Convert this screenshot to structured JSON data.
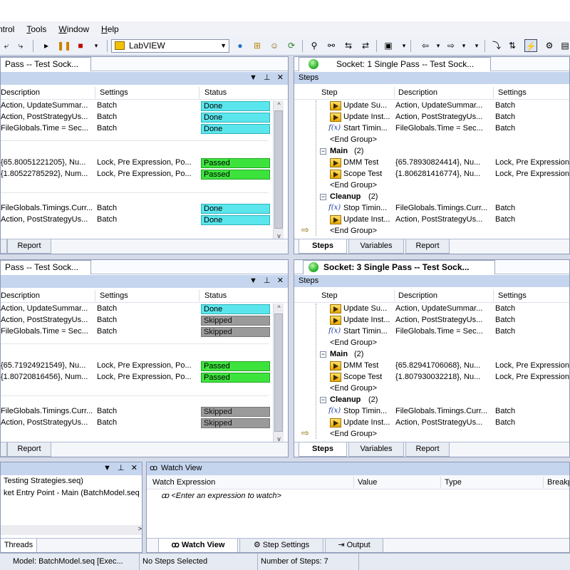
{
  "menu": [
    "ntrol",
    "Tools",
    "Window",
    "Help"
  ],
  "toolbar": {
    "adapter": "LabVIEW"
  },
  "pane1": {
    "tab": "Pass -- Test Sock...",
    "columns": [
      "Description",
      "Settings",
      "Status"
    ],
    "rows": [
      {
        "desc": "Action,  UpdateSummar...",
        "settings": "Batch",
        "status": "Done",
        "kind": "done"
      },
      {
        "desc": "Action,  PostStrategyUs...",
        "settings": "Batch",
        "status": "Done",
        "kind": "done"
      },
      {
        "desc": "FileGlobals.Time = Sec...",
        "settings": "Batch",
        "status": "Done",
        "kind": "done"
      },
      {
        "desc": "{65.80051221205}, Nu...",
        "settings": "Lock, Pre Expression, Po...",
        "status": "Passed",
        "kind": "passed"
      },
      {
        "desc": "{1.80522785292}, Num...",
        "settings": "Lock, Pre Expression, Po...",
        "status": "Passed",
        "kind": "passed"
      },
      {
        "desc": "FileGlobals.Timings.Curr...",
        "settings": "Batch",
        "status": "Done",
        "kind": "done"
      },
      {
        "desc": "Action,  PostStrategyUs...",
        "settings": "Batch",
        "status": "Done",
        "kind": "done"
      }
    ],
    "report_tab": "Report"
  },
  "pane2": {
    "tab": "Socket: 1  Single Pass -- Test Sock...",
    "subbar": "Steps",
    "columns": [
      "Step",
      "Description",
      "Settings"
    ],
    "rows": [
      {
        "type": "step",
        "step": "Update Su...",
        "desc": "Action,  UpdateSummar...",
        "settings": "Batch"
      },
      {
        "type": "step",
        "step": "Update Inst...",
        "desc": "Action,  PostStrategyUs...",
        "settings": "Batch"
      },
      {
        "type": "fx",
        "step": "Start Timin...",
        "desc": "FileGlobals.Time = Sec...",
        "settings": "Batch"
      },
      {
        "type": "end",
        "step": "<End Group>",
        "desc": "",
        "settings": ""
      },
      {
        "type": "group",
        "step": "Main",
        "count": "(2)"
      },
      {
        "type": "step",
        "step": "DMM Test",
        "desc": "{65.78930824414}, Nu...",
        "settings": "Lock, Pre Expression"
      },
      {
        "type": "step",
        "step": "Scope Test",
        "desc": "{1.806281416774}, Nu...",
        "settings": "Lock, Pre Expression"
      },
      {
        "type": "end",
        "step": "<End Group>",
        "desc": "",
        "settings": ""
      },
      {
        "type": "group",
        "step": "Cleanup",
        "count": "(2)"
      },
      {
        "type": "fx",
        "step": "Stop Timin...",
        "desc": "FileGlobals.Timings.Curr...",
        "settings": "Batch"
      },
      {
        "type": "step",
        "step": "Update Inst...",
        "desc": "Action,  PostStrategyUs...",
        "settings": "Batch"
      },
      {
        "type": "end",
        "step": "<End Group>",
        "desc": "",
        "settings": ""
      }
    ],
    "tabs": [
      "Steps",
      "Variables",
      "Report"
    ]
  },
  "pane3": {
    "tab": "Pass -- Test Sock...",
    "columns": [
      "Description",
      "Settings",
      "Status"
    ],
    "rows": [
      {
        "desc": "Action,  UpdateSummar...",
        "settings": "Batch",
        "status": "Done",
        "kind": "done"
      },
      {
        "desc": "Action,  PostStrategyUs...",
        "settings": "Batch",
        "status": "Skipped",
        "kind": "skipped"
      },
      {
        "desc": "FileGlobals.Time = Sec...",
        "settings": "Batch",
        "status": "Skipped",
        "kind": "skipped"
      },
      {
        "desc": "{65.71924921549}, Nu...",
        "settings": "Lock, Pre Expression, Po...",
        "status": "Passed",
        "kind": "passed"
      },
      {
        "desc": "{1.80720816456}, Num...",
        "settings": "Lock, Pre Expression, Po...",
        "status": "Passed",
        "kind": "passed"
      },
      {
        "desc": "FileGlobals.Timings.Curr...",
        "settings": "Batch",
        "status": "Skipped",
        "kind": "skipped"
      },
      {
        "desc": "Action,  PostStrategyUs...",
        "settings": "Batch",
        "status": "Skipped",
        "kind": "skipped"
      }
    ],
    "report_tab": "Report"
  },
  "pane4": {
    "tab": "Socket: 3  Single Pass -- Test Sock...",
    "subbar": "Steps",
    "columns": [
      "Step",
      "Description",
      "Settings"
    ],
    "rows": [
      {
        "type": "step",
        "step": "Update Su...",
        "desc": "Action,  UpdateSummar...",
        "settings": "Batch"
      },
      {
        "type": "step",
        "step": "Update Inst...",
        "desc": "Action,  PostStrategyUs...",
        "settings": "Batch"
      },
      {
        "type": "fx",
        "step": "Start Timin...",
        "desc": "FileGlobals.Time = Sec...",
        "settings": "Batch"
      },
      {
        "type": "end",
        "step": "<End Group>",
        "desc": "",
        "settings": ""
      },
      {
        "type": "group",
        "step": "Main",
        "count": "(2)"
      },
      {
        "type": "step",
        "step": "DMM Test",
        "desc": "{65.82941706068}, Nu...",
        "settings": "Lock, Pre Expression"
      },
      {
        "type": "step",
        "step": "Scope Test",
        "desc": "{1.807930032218}, Nu...",
        "settings": "Lock, Pre Expression"
      },
      {
        "type": "end",
        "step": "<End Group>",
        "desc": "",
        "settings": ""
      },
      {
        "type": "group",
        "step": "Cleanup",
        "count": "(2)"
      },
      {
        "type": "fx",
        "step": "Stop Timin...",
        "desc": "FileGlobals.Timings.Curr...",
        "settings": "Batch"
      },
      {
        "type": "step",
        "step": "Update Inst...",
        "desc": "Action,  PostStrategyUs...",
        "settings": "Batch"
      },
      {
        "type": "end",
        "step": "<End Group>",
        "desc": "",
        "settings": ""
      }
    ],
    "tabs": [
      "Steps",
      "Variables",
      "Report"
    ]
  },
  "callstack": {
    "rows": [
      "Testing Strategies.seq)",
      "ket Entry Point - Main (BatchModel.seq"
    ],
    "tab": "Threads"
  },
  "watch": {
    "title": "Watch View",
    "columns": [
      "Watch Expression",
      "Value",
      "Type",
      "Breakp"
    ],
    "placeholder": "<Enter an expression to watch>",
    "tabs": [
      "Watch View",
      "Step Settings",
      "Output"
    ]
  },
  "statusbar": [
    "Model: BatchModel.seq [Exec...",
    "No Steps Selected",
    "Number of Steps: 7"
  ]
}
